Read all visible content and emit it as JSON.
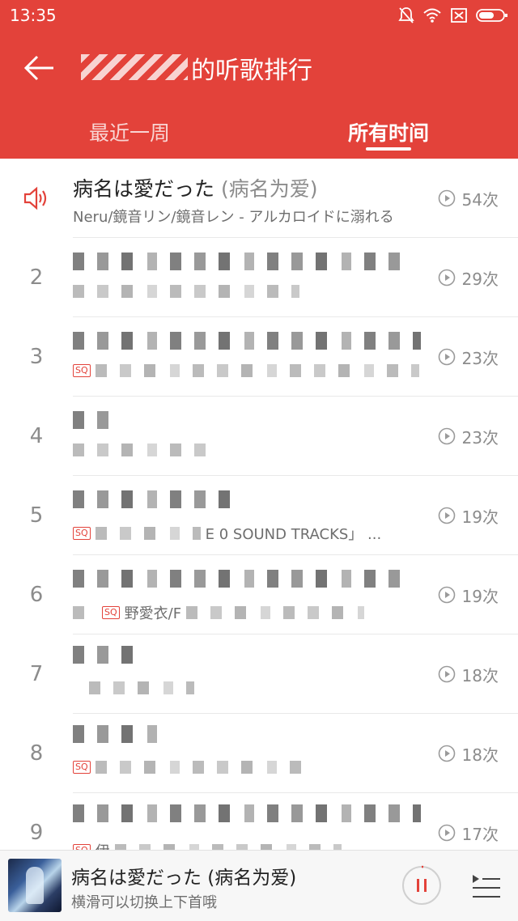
{
  "status_bar": {
    "time": "13:35"
  },
  "header": {
    "title_visible": "的听歌排行",
    "tabs": [
      {
        "label": "最近一周"
      },
      {
        "label": "所有时间"
      }
    ],
    "active_tab": "所有时间"
  },
  "list": [
    {
      "rank": "",
      "title": "病名は愛だった",
      "alias": "(病名为爱)",
      "subtitle": "Neru/鏡音リン/鏡音レン - アルカロイドに溺れる",
      "count": "54次",
      "playing": true
    },
    {
      "rank": "2",
      "title": "",
      "subtitle": "",
      "count": "29次"
    },
    {
      "rank": "3",
      "title": "",
      "subtitle": "",
      "count": "23次"
    },
    {
      "rank": "4",
      "title": "",
      "subtitle": "",
      "count": "23次"
    },
    {
      "rank": "5",
      "title": "",
      "subtitle": "E 0 SOUND TRACKS」 ...",
      "count": "19次"
    },
    {
      "rank": "6",
      "title": "",
      "subtitle": "野愛衣/F",
      "count": "19次"
    },
    {
      "rank": "7",
      "title": "",
      "subtitle": "",
      "count": "18次"
    },
    {
      "rank": "8",
      "title": "",
      "subtitle": "",
      "count": "18次"
    },
    {
      "rank": "9",
      "title": "",
      "subtitle": "伊",
      "count": "17次"
    }
  ],
  "player": {
    "title": "病名は愛だった (病名为爱)",
    "hint": "横滑可以切换上下首哦"
  },
  "colors": {
    "accent": "#e3423a",
    "badge": "#e3423a"
  },
  "icons": [
    "back-arrow-icon",
    "speaker-icon",
    "play-circle-icon",
    "pause-icon",
    "playlist-icon",
    "mute-icon",
    "wifi-icon",
    "sim-icon",
    "battery-icon"
  ]
}
